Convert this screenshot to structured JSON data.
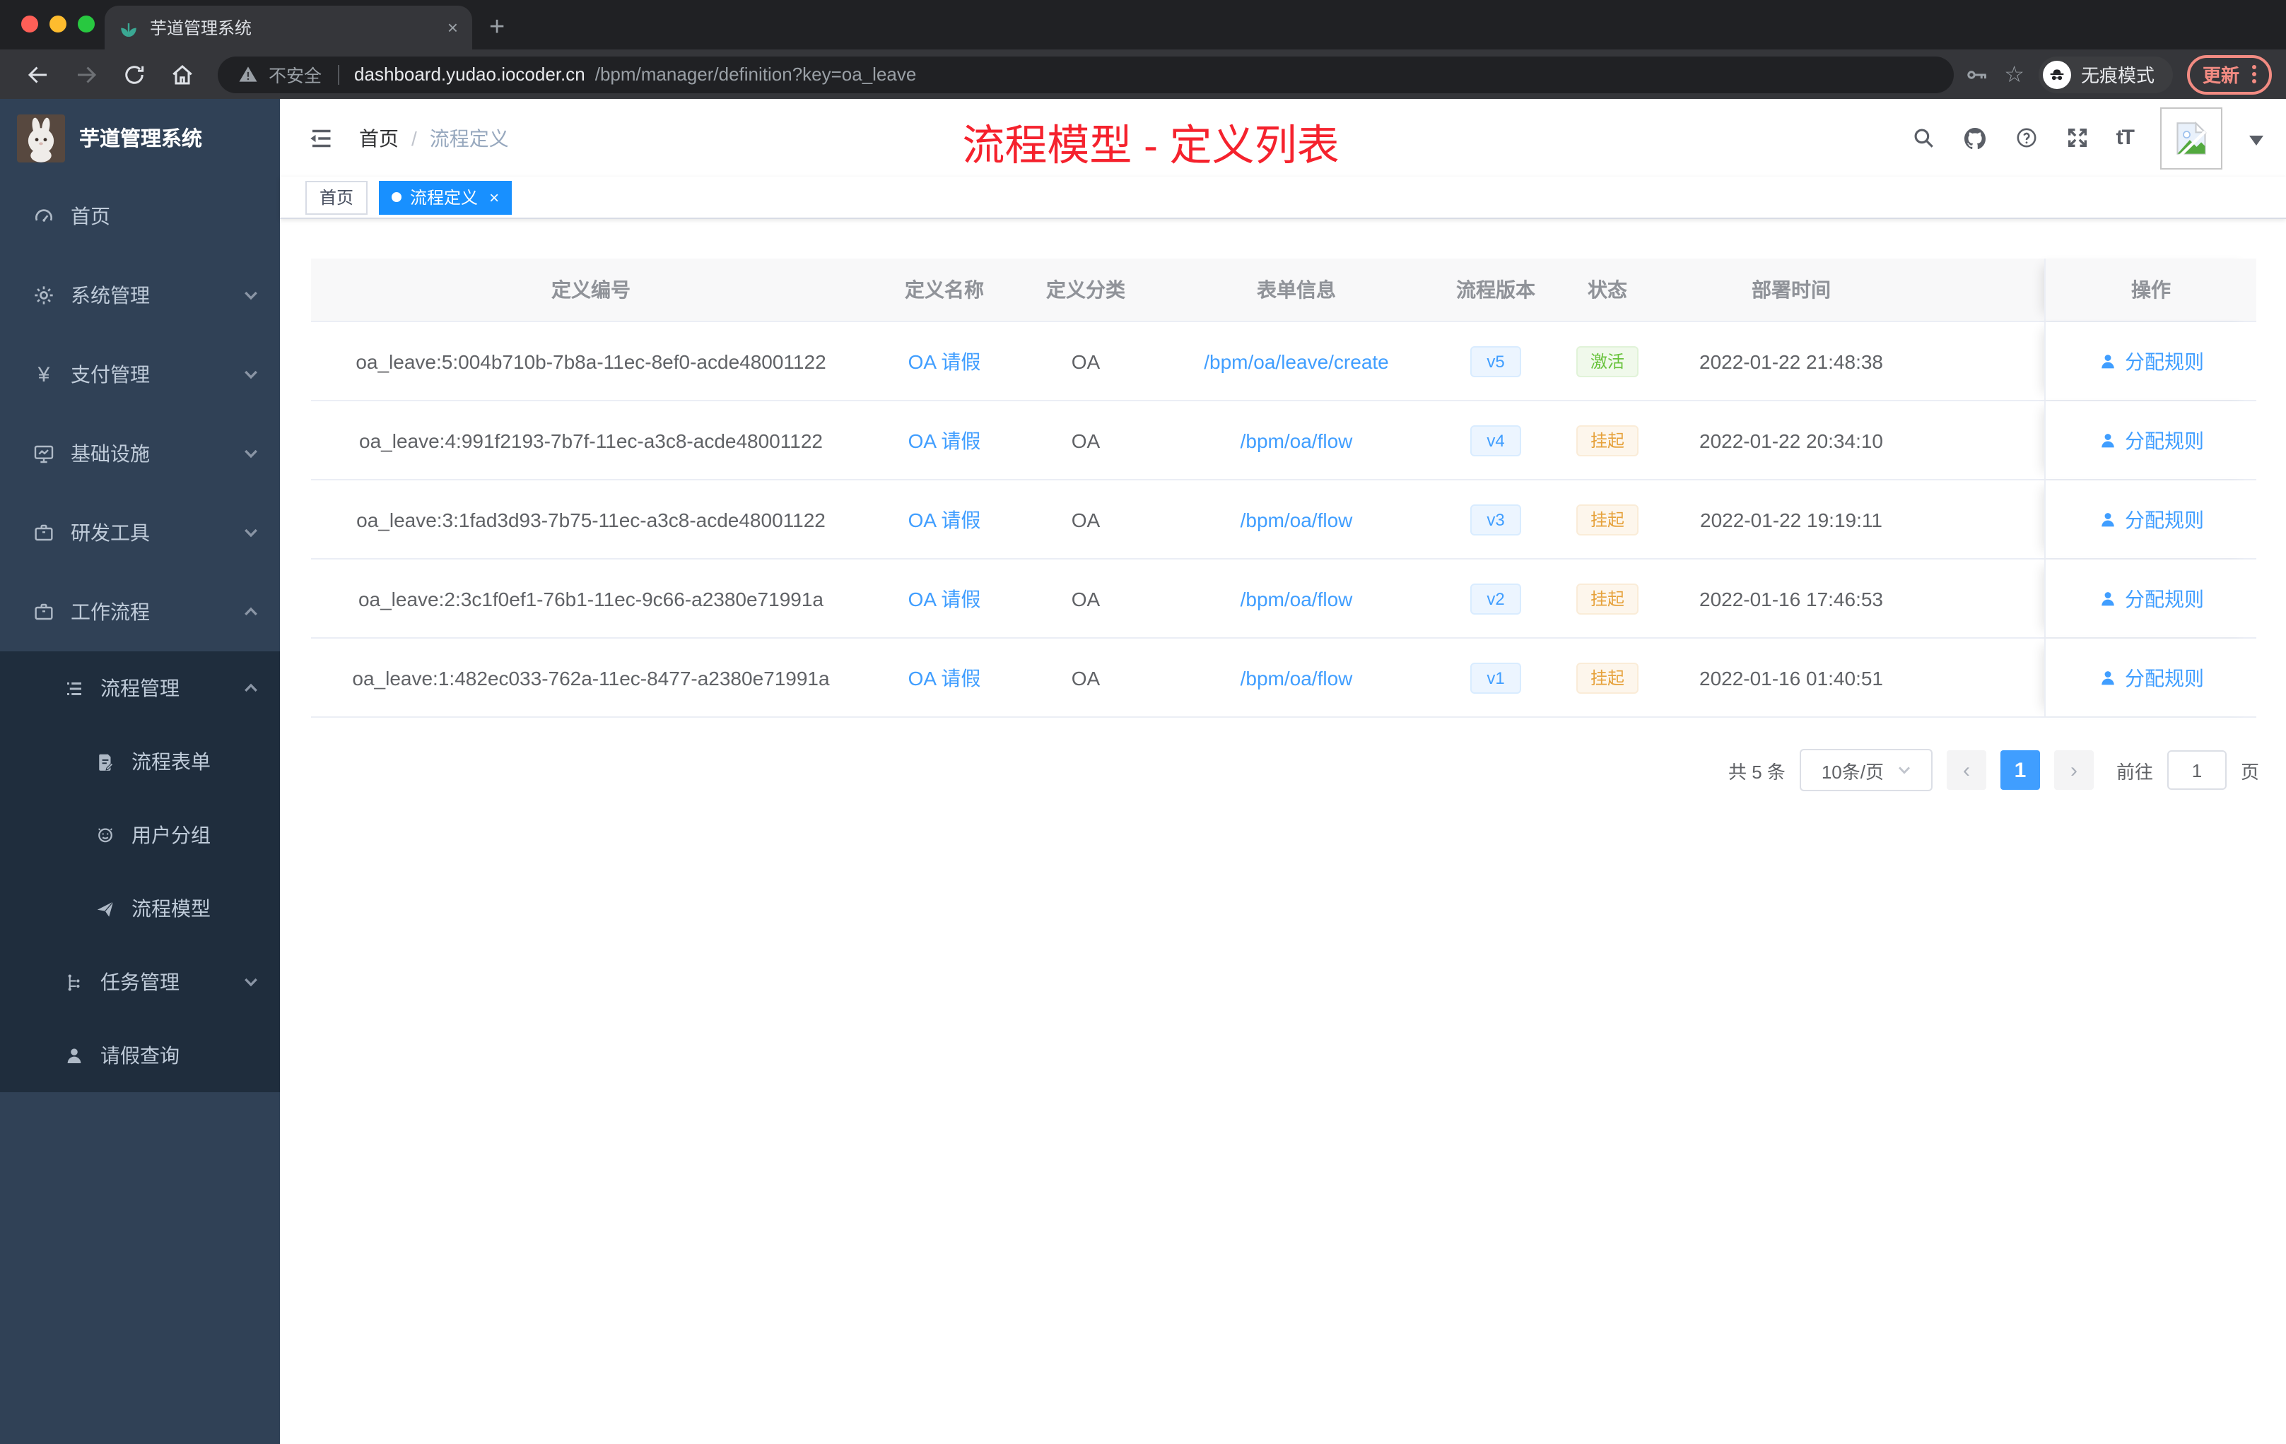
{
  "browser": {
    "tab": {
      "title": "芋道管理系统",
      "close": "×",
      "new_tab": "+"
    },
    "address": {
      "warning": "不安全",
      "host": "dashboard.yudao.iocoder.cn",
      "path": "/bpm/manager/definition?key=oa_leave"
    },
    "incognito_label": "无痕模式",
    "update_label": "更新"
  },
  "sidebar": {
    "logo_title": "芋道管理系统",
    "menu": [
      {
        "label": "首页"
      },
      {
        "label": "系统管理"
      },
      {
        "label": "支付管理"
      },
      {
        "label": "基础设施"
      },
      {
        "label": "研发工具"
      },
      {
        "label": "工作流程"
      }
    ],
    "submenu": [
      {
        "label": "流程管理"
      },
      {
        "label": "流程表单"
      },
      {
        "label": "用户分组"
      },
      {
        "label": "流程模型"
      },
      {
        "label": "任务管理"
      },
      {
        "label": "请假查询"
      }
    ]
  },
  "header": {
    "breadcrumb_home": "首页",
    "breadcrumb_sep": "/",
    "breadcrumb_current": "流程定义",
    "annotation": "流程模型 - 定义列表",
    "font_icon_label": "tT"
  },
  "tags": {
    "home": "首页",
    "active": "流程定义",
    "close": "×"
  },
  "table": {
    "columns": [
      "定义编号",
      "定义名称",
      "定义分类",
      "表单信息",
      "流程版本",
      "状态",
      "部署时间",
      "操作"
    ],
    "rows": [
      {
        "id": "oa_leave:5:004b710b-7b8a-11ec-8ef0-acde48001122",
        "name": "OA 请假",
        "category": "OA",
        "form": "/bpm/oa/leave/create",
        "version": "v5",
        "status": "激活",
        "status_type": "success",
        "time": "2022-01-22 21:48:38",
        "action": "分配规则"
      },
      {
        "id": "oa_leave:4:991f2193-7b7f-11ec-a3c8-acde48001122",
        "name": "OA 请假",
        "category": "OA",
        "form": "/bpm/oa/flow",
        "version": "v4",
        "status": "挂起",
        "status_type": "warning",
        "time": "2022-01-22 20:34:10",
        "action": "分配规则"
      },
      {
        "id": "oa_leave:3:1fad3d93-7b75-11ec-a3c8-acde48001122",
        "name": "OA 请假",
        "category": "OA",
        "form": "/bpm/oa/flow",
        "version": "v3",
        "status": "挂起",
        "status_type": "warning",
        "time": "2022-01-22 19:19:11",
        "action": "分配规则"
      },
      {
        "id": "oa_leave:2:3c1f0ef1-76b1-11ec-9c66-a2380e71991a",
        "name": "OA 请假",
        "category": "OA",
        "form": "/bpm/oa/flow",
        "version": "v2",
        "status": "挂起",
        "status_type": "warning",
        "time": "2022-01-16 17:46:53",
        "action": "分配规则"
      },
      {
        "id": "oa_leave:1:482ec033-762a-11ec-8477-a2380e71991a",
        "name": "OA 请假",
        "category": "OA",
        "form": "/bpm/oa/flow",
        "version": "v1",
        "status": "挂起",
        "status_type": "warning",
        "time": "2022-01-16 01:40:51",
        "action": "分配规则"
      }
    ]
  },
  "pagination": {
    "total": "共 5 条",
    "page_size": "10条/页",
    "prev": "‹",
    "page": "1",
    "next": "›",
    "goto_label": "前往",
    "goto_value": "1",
    "goto_unit": "页"
  },
  "icons": {
    "browser": [
      "back-icon",
      "forward-icon",
      "reload-icon",
      "home-icon",
      "warning-icon",
      "key-icon",
      "star-icon",
      "incognito-icon",
      "kebab-icon"
    ],
    "header": [
      "hamburger-icon",
      "search-icon",
      "github-icon",
      "question-icon",
      "fullscreen-icon",
      "font-size-icon",
      "avatar",
      "chevron-down-icon"
    ],
    "sidebar": [
      "dashboard-icon",
      "gear-icon",
      "yen-icon",
      "monitor-icon",
      "briefcase-icon",
      "list-icon",
      "form-icon",
      "people-icon",
      "plane-icon",
      "tree-icon",
      "user-icon"
    ]
  },
  "colors": {
    "accent": "#409eff",
    "theme_tag": "#1890ff",
    "success": "#67c23a",
    "warning": "#e6a23c",
    "annotation_red": "#f5222d",
    "sidebar_bg": "#304156",
    "submenu_bg": "#1f2d3d",
    "table_header_bg": "#f8f8f9"
  }
}
